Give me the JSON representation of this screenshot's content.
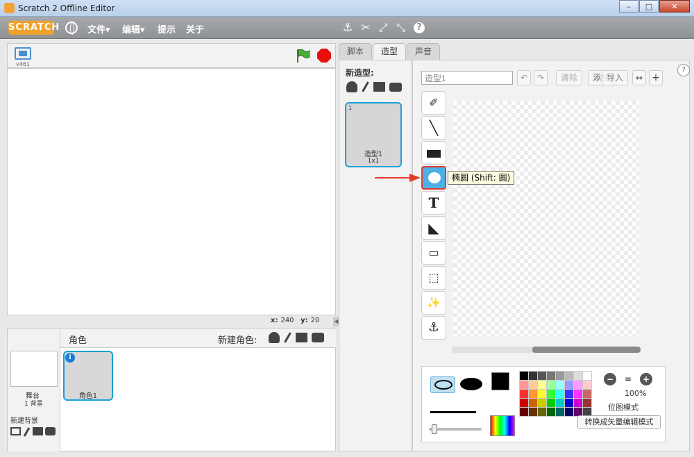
{
  "window": {
    "title": "Scratch 2 Offline Editor",
    "min": "–",
    "max": "□",
    "close": "✕"
  },
  "menubar": {
    "logo": "SCRATCH",
    "items": [
      "文件▾",
      "编辑▾",
      "提示",
      "关于"
    ]
  },
  "stage": {
    "version": "v461",
    "x_label": "x:",
    "x_value": "240",
    "y_label": "y:",
    "y_value": "20"
  },
  "sprites": {
    "header": "角色",
    "new_sprite": "新建角色:",
    "stage_label": "舞台",
    "backdrop_count": "1 背景",
    "new_backdrop": "新建背景",
    "sprite_name": "角色1",
    "info": "i"
  },
  "tabs": [
    "脚本",
    "造型",
    "声音"
  ],
  "costumes": {
    "new_label": "新造型:",
    "index": "1",
    "name": "造型1",
    "size": "1x1"
  },
  "editor": {
    "name_value": "造型1",
    "clear": "清除",
    "add": "添加",
    "import": "导入",
    "tooltip": "椭圆 (Shift: 圆)",
    "zoom": "100%",
    "mode": "位图模式",
    "convert": "转换成矢量编辑模式",
    "zoom_minus": "−",
    "zoom_eq": "=",
    "zoom_plus": "+"
  },
  "colors": {
    "accent": "#1aa0d8",
    "active_tool": "#4cb0e4",
    "highlight": "#e53a2a",
    "menubar": "#9a9c9f"
  }
}
